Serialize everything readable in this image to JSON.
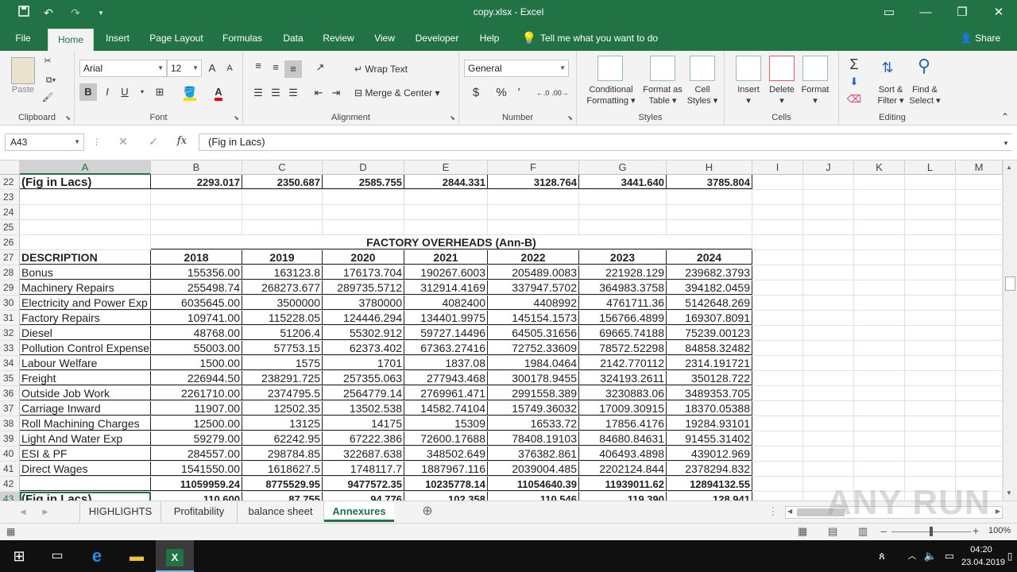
{
  "titlebar": {
    "title": "copy.xlsx  -  Excel",
    "save_icon": "save-icon",
    "undo_icon": "undo-icon",
    "redo_icon": "redo-icon",
    "qat_icon": "customize-icon"
  },
  "ribbon_tabs": [
    "File",
    "Home",
    "Insert",
    "Page Layout",
    "Formulas",
    "Data",
    "Review",
    "View",
    "Developer",
    "Help"
  ],
  "tell_me": "Tell me what you want to do",
  "share": "Share",
  "groups": {
    "clipboard": {
      "name": "Clipboard",
      "paste": "Paste"
    },
    "font": {
      "name": "Font",
      "font_name": "Arial",
      "font_size": "12",
      "bold": "B",
      "italic": "I",
      "underline": "U",
      "grow": "A",
      "shrink": "A"
    },
    "alignment": {
      "name": "Alignment",
      "wrap": "Wrap Text",
      "merge": "Merge & Center"
    },
    "number": {
      "name": "Number",
      "format": "General",
      "currency": "$",
      "percent": "%",
      "comma": "’"
    },
    "styles": {
      "name": "Styles",
      "conditional": [
        "Conditional",
        "Formatting"
      ],
      "format_table": [
        "Format as",
        "Table"
      ],
      "cell_styles": [
        "Cell",
        "Styles"
      ]
    },
    "cells": {
      "name": "Cells",
      "insert": "Insert",
      "delete": "Delete",
      "format": "Format"
    },
    "editing": {
      "name": "Editing",
      "sort": [
        "Sort &",
        "Filter"
      ],
      "find": [
        "Find &",
        "Select"
      ]
    }
  },
  "formula_bar": {
    "name_box": "A43",
    "fx": "fx",
    "formula": "(Fig in Lacs)"
  },
  "columns": [
    "A",
    "B",
    "C",
    "D",
    "E",
    "F",
    "G",
    "H",
    "I",
    "J",
    "K",
    "L",
    "M"
  ],
  "rows": [
    {
      "n": "22",
      "cells": [
        "(Fig in Lacs)",
        "2293.017",
        "2350.687",
        "2585.755",
        "2844.331",
        "3128.764",
        "3441.640",
        "3785.804"
      ]
    },
    {
      "n": "23",
      "cells": [
        "",
        "",
        "",
        "",
        "",
        "",
        "",
        ""
      ]
    },
    {
      "n": "24",
      "cells": [
        "",
        "",
        "",
        "",
        "",
        "",
        "",
        ""
      ]
    },
    {
      "n": "25",
      "cells": [
        "",
        "",
        "",
        "",
        "",
        "",
        "",
        ""
      ]
    },
    {
      "n": "26",
      "cells": [
        "",
        "",
        "",
        "",
        "",
        "",
        "",
        ""
      ],
      "title": "FACTORY OVERHEADS   (Ann-B)"
    },
    {
      "n": "27",
      "cells": [
        "DESCRIPTION",
        "2018",
        "2019",
        "2020",
        "2021",
        "2022",
        "2023",
        "2024"
      ]
    },
    {
      "n": "28",
      "cells": [
        "Bonus",
        "155356.00",
        "163123.8",
        "176173.704",
        "190267.6003",
        "205489.0083",
        "221928.129",
        "239682.3793"
      ]
    },
    {
      "n": "29",
      "cells": [
        "Machinery Repairs",
        "255498.74",
        "268273.677",
        "289735.5712",
        "312914.4169",
        "337947.5702",
        "364983.3758",
        "394182.0459"
      ]
    },
    {
      "n": "30",
      "cells": [
        "Electricity and Power Exp",
        "6035645.00",
        "3500000",
        "3780000",
        "4082400",
        "4408992",
        "4761711.36",
        "5142648.269"
      ]
    },
    {
      "n": "31",
      "cells": [
        "Factory Repairs",
        "109741.00",
        "115228.05",
        "124446.294",
        "134401.9975",
        "145154.1573",
        "156766.4899",
        "169307.8091"
      ]
    },
    {
      "n": "32",
      "cells": [
        "Diesel",
        "48768.00",
        "51206.4",
        "55302.912",
        "59727.14496",
        "64505.31656",
        "69665.74188",
        "75239.00123"
      ]
    },
    {
      "n": "33",
      "cells": [
        "Pollution Control Expenses",
        "55003.00",
        "57753.15",
        "62373.402",
        "67363.27416",
        "72752.33609",
        "78572.52298",
        "84858.32482"
      ]
    },
    {
      "n": "34",
      "cells": [
        "Labour Welfare",
        "1500.00",
        "1575",
        "1701",
        "1837.08",
        "1984.0464",
        "2142.770112",
        "2314.191721"
      ]
    },
    {
      "n": "35",
      "cells": [
        "Freight",
        "226944.50",
        "238291.725",
        "257355.063",
        "277943.468",
        "300178.9455",
        "324193.2611",
        "350128.722"
      ]
    },
    {
      "n": "36",
      "cells": [
        "Outside Job Work",
        "2261710.00",
        "2374795.5",
        "2564779.14",
        "2769961.471",
        "2991558.389",
        "3230883.06",
        "3489353.705"
      ]
    },
    {
      "n": "37",
      "cells": [
        "Carriage Inward",
        "11907.00",
        "12502.35",
        "13502.538",
        "14582.74104",
        "15749.36032",
        "17009.30915",
        "18370.05388"
      ]
    },
    {
      "n": "38",
      "cells": [
        "Roll Machining Charges",
        "12500.00",
        "13125",
        "14175",
        "15309",
        "16533.72",
        "17856.4176",
        "19284.93101"
      ]
    },
    {
      "n": "39",
      "cells": [
        "Light And Water Exp",
        "59279.00",
        "62242.95",
        "67222.386",
        "72600.17688",
        "78408.19103",
        "84680.84631",
        "91455.31402"
      ]
    },
    {
      "n": "40",
      "cells": [
        "ESI & PF",
        "284557.00",
        "298784.85",
        "322687.638",
        "348502.649",
        "376382.861",
        "406493.4898",
        "439012.969"
      ]
    },
    {
      "n": "41",
      "cells": [
        "Direct Wages",
        "1541550.00",
        "1618627.5",
        "1748117.7",
        "1887967.116",
        "2039004.485",
        "2202124.844",
        "2378294.832"
      ]
    },
    {
      "n": "42",
      "cells": [
        "",
        "11059959.24",
        "8775529.95",
        "9477572.35",
        "10235778.14",
        "11054640.39",
        "11939011.62",
        "12894132.55"
      ]
    },
    {
      "n": "43",
      "cells": [
        "(Fig in Lacs)",
        "110.600",
        "87.755",
        "94.776",
        "102.358",
        "110.546",
        "119.390",
        "128.941"
      ]
    }
  ],
  "sheets": [
    "HIGHLIGHTS",
    "Profitability",
    "balance sheet",
    "Annexures"
  ],
  "active_sheet": "Annexures",
  "status": {
    "zoom": "100%"
  },
  "taskbar": {
    "time": "04:20",
    "date": "23.04.2019"
  },
  "watermark": "ANY RUN"
}
